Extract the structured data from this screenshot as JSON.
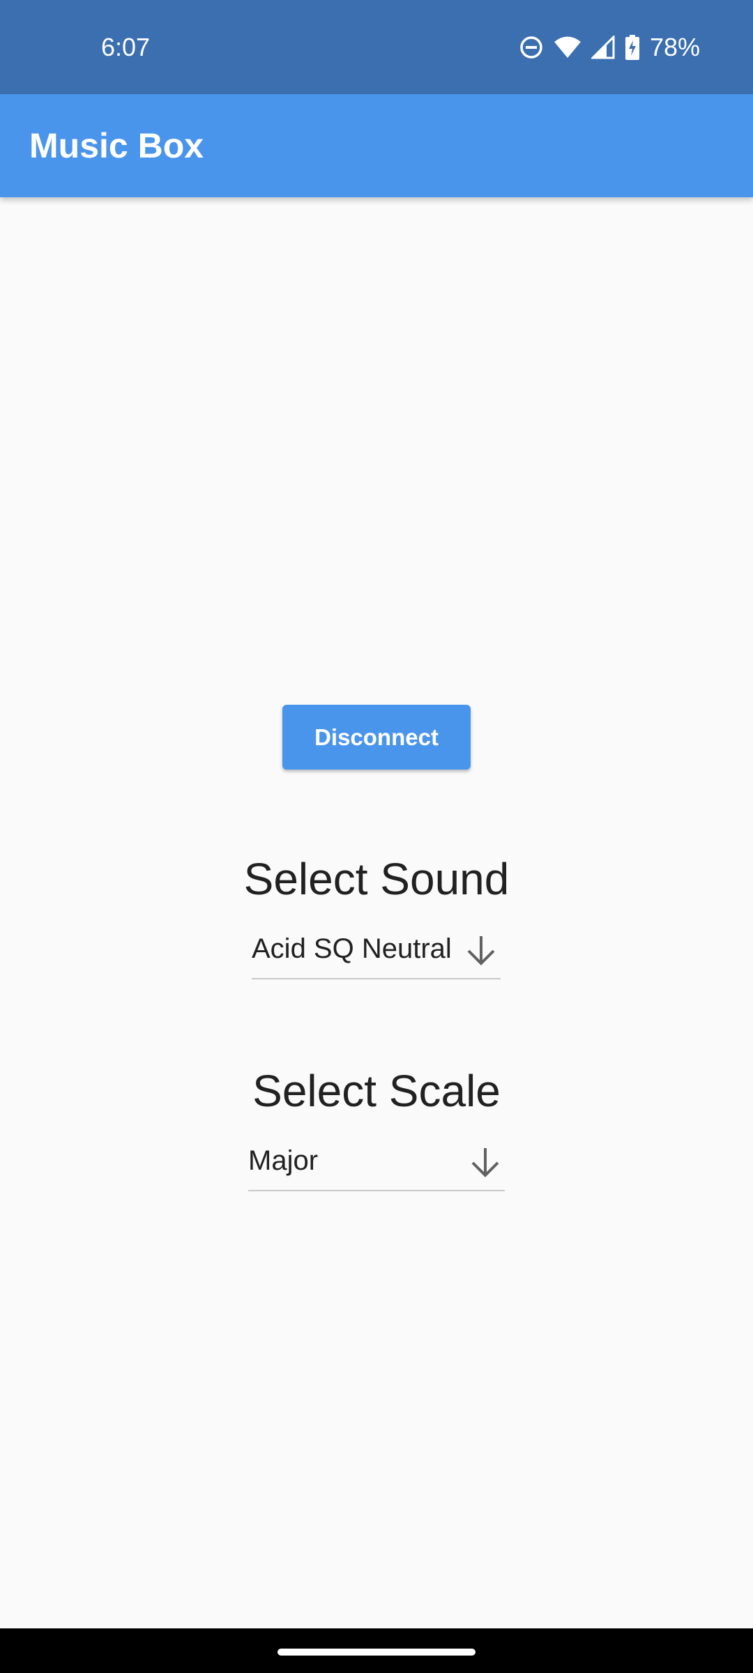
{
  "status_bar": {
    "time": "6:07",
    "battery_percent": "78%",
    "icons": [
      "do-not-disturb-icon",
      "wifi-icon",
      "cell-signal-icon",
      "battery-charging-icon"
    ]
  },
  "app_bar": {
    "title": "Music Box",
    "color": "#4a95ec"
  },
  "main": {
    "disconnect_label": "Disconnect",
    "sound": {
      "title": "Select Sound",
      "selected": "Acid SQ Neutral"
    },
    "scale": {
      "title": "Select Scale",
      "selected": "Major"
    }
  },
  "colors": {
    "status_bar": "#3b6fb0",
    "accent": "#4a95ec",
    "background": "#fafafa"
  }
}
